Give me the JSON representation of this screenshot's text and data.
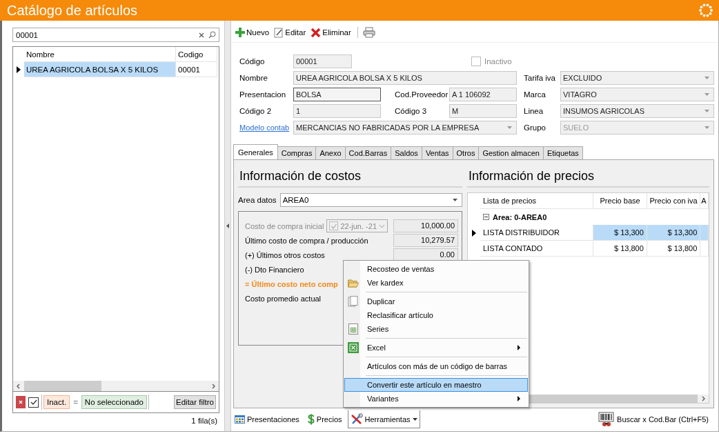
{
  "window": {
    "title": "Catálogo de artículos"
  },
  "search": {
    "value": "00001"
  },
  "list": {
    "columns": [
      "Nombre",
      "Codigo"
    ],
    "rows": [
      {
        "cells": [
          "UREA AGRICOLA BOLSA X 5 KILOS",
          "00001"
        ],
        "selected": true
      }
    ]
  },
  "filter": {
    "checked": true,
    "field": "Inact.",
    "operator": "=",
    "value": "No seleccionado",
    "edit_button": "Editar filtro"
  },
  "row_count": "1 fila(s)",
  "toolbar": [
    {
      "label": "Nuevo",
      "kind": "new"
    },
    {
      "label": "Editar",
      "kind": "edit"
    },
    {
      "label": "Eliminar",
      "kind": "delete"
    },
    {
      "kind": "print"
    }
  ],
  "form": {
    "rows": [
      [
        {
          "label": "Código",
          "value": "00001",
          "kind": "text"
        },
        {
          "label": "Inactivo",
          "kind": "checkbox",
          "checked": false
        }
      ],
      [
        {
          "label": "Nombre",
          "value": "UREA AGRICOLA BOLSA X 5 KILOS",
          "kind": "text"
        },
        {
          "label": "Tarifa iva",
          "value": "EXCLUIDO",
          "kind": "combo"
        }
      ],
      [
        {
          "label": "Presentacion",
          "value": "BOLSA",
          "kind": "text",
          "focused": true
        },
        {
          "label": "Cod.Proveedor",
          "value": "A 1 106092",
          "kind": "text"
        },
        {
          "label": "Marca",
          "value": "VITAGRO",
          "kind": "combo"
        }
      ],
      [
        {
          "label": "Código 2",
          "value": "1",
          "kind": "text"
        },
        {
          "label": "Código 3",
          "value": "M",
          "kind": "text"
        },
        {
          "label": "Linea",
          "value": "INSUMOS AGRICOLAS",
          "kind": "combo"
        }
      ],
      [
        {
          "label": "Modelo contab",
          "value": "MERCANCIAS NO FABRICADAS POR LA EMPRESA",
          "kind": "combo",
          "link": true
        },
        {
          "label": "Grupo",
          "value": "SUELO",
          "kind": "combo",
          "disabled": true
        }
      ]
    ]
  },
  "tabs": [
    {
      "label": "Generales",
      "selected": true
    },
    {
      "label": "Compras",
      "selected": false
    },
    {
      "label": "Anexo",
      "selected": false
    },
    {
      "label": "Cod.Barras",
      "selected": false
    },
    {
      "label": "Saldos",
      "selected": false
    },
    {
      "label": "Ventas",
      "selected": false
    },
    {
      "label": "Otros",
      "selected": false
    },
    {
      "label": "Gestion almacen",
      "selected": false
    },
    {
      "label": "Etiquetas",
      "selected": false
    }
  ],
  "costs": {
    "title": "Información de costos",
    "area_label": "Area datos",
    "area_value": "AREA0",
    "rows": [
      {
        "label": "Costo de compra inicial",
        "kind": "disabled",
        "date": "22-jun. -21",
        "date_checked": true,
        "value": "10,000.00"
      },
      {
        "label": "Último costo de compra / producción",
        "kind": "normal",
        "value": "10,279.57"
      },
      {
        "label": "(+) Últimos otros costos",
        "kind": "normal",
        "value": "0.00"
      },
      {
        "label": "(-) Dto Financiero",
        "kind": "normal"
      },
      {
        "label": "= Último costo neto comp",
        "kind": "highlight"
      },
      {
        "label": "Costo promedio actual",
        "kind": "normal"
      }
    ]
  },
  "prices": {
    "title": "Información de precios",
    "columns": [
      "Lista de precios",
      "Precio base",
      "Precio con iva",
      "A"
    ],
    "group": {
      "label": "Area: 0-AREA0",
      "expanded": true
    },
    "rows": [
      {
        "cells": [
          "LISTA DISTRIBUIDOR",
          "$ 13,300",
          "$ 13,300"
        ],
        "selected": true
      },
      {
        "cells": [
          "LISTA CONTADO",
          "$ 13,800",
          "$ 13,800"
        ],
        "selected": false
      }
    ]
  },
  "context_menu": [
    {
      "kind": "item",
      "label": "Recosteo de ventas",
      "submenu": false,
      "selected": false
    },
    {
      "kind": "item",
      "label": "Ver kardex",
      "submenu": false,
      "selected": false
    },
    {
      "kind": "separator"
    },
    {
      "kind": "item",
      "label": "Duplicar",
      "submenu": false,
      "selected": false
    },
    {
      "kind": "item",
      "label": "Reclasificar artículo",
      "submenu": false,
      "selected": false
    },
    {
      "kind": "item",
      "label": "Series",
      "submenu": false,
      "selected": false
    },
    {
      "kind": "separator"
    },
    {
      "kind": "item",
      "label": "Excel",
      "submenu": true,
      "selected": false
    },
    {
      "kind": "separator"
    },
    {
      "kind": "item",
      "label": "Artículos con más de un código de barras",
      "submenu": false,
      "selected": false
    },
    {
      "kind": "separator"
    },
    {
      "kind": "item",
      "label": "Convertir este artículo en maestro",
      "submenu": false,
      "selected": true
    },
    {
      "kind": "item",
      "label": "Variantes",
      "submenu": true,
      "selected": false
    }
  ],
  "bottom_bar": [
    {
      "label": "Presentaciones",
      "kind": "presentations"
    },
    {
      "label": "Precios",
      "kind": "prices"
    },
    {
      "label": "Herramientas",
      "kind": "tools",
      "dropdown": true,
      "pressed": true
    }
  ],
  "barcode_search": {
    "label": "Buscar x Cod.Bar (Ctrl+F5)"
  }
}
